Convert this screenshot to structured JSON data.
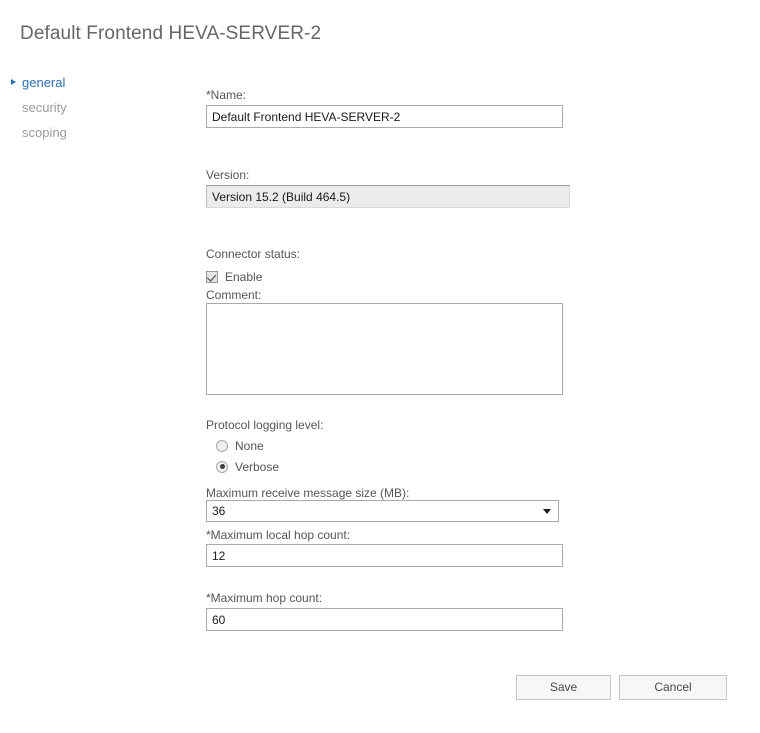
{
  "page": {
    "title": "Default Frontend HEVA-SERVER-2"
  },
  "sidebar": {
    "items": [
      {
        "label": "general",
        "selected": true
      },
      {
        "label": "security",
        "selected": false
      },
      {
        "label": "scoping",
        "selected": false
      }
    ]
  },
  "form": {
    "name": {
      "label": "*Name:",
      "value": "Default Frontend HEVA-SERVER-2"
    },
    "version": {
      "label": "Version:",
      "value": "Version 15.2 (Build 464.5)"
    },
    "connector_status": {
      "label": "Connector status:",
      "checkbox_label": "Enable",
      "checked": true
    },
    "comment": {
      "label": "Comment:",
      "value": ""
    },
    "protocol_logging": {
      "label": "Protocol logging level:",
      "options": [
        {
          "label": "None",
          "selected": false
        },
        {
          "label": "Verbose",
          "selected": true
        }
      ],
      "selected_value": "Verbose"
    },
    "max_receive_message_size": {
      "label": "Maximum receive message size (MB):",
      "value": "36"
    },
    "max_local_hop_count": {
      "label": "*Maximum local hop count:",
      "value": "12"
    },
    "max_hop_count": {
      "label": "*Maximum hop count:",
      "value": "60"
    }
  },
  "footer": {
    "save_label": "Save",
    "cancel_label": "Cancel"
  },
  "colors": {
    "accent": "#2a6fb5",
    "title": "#666666",
    "label": "#555555",
    "disabled_bg": "#ebebeb",
    "button_bg": "#f7f7f7"
  }
}
